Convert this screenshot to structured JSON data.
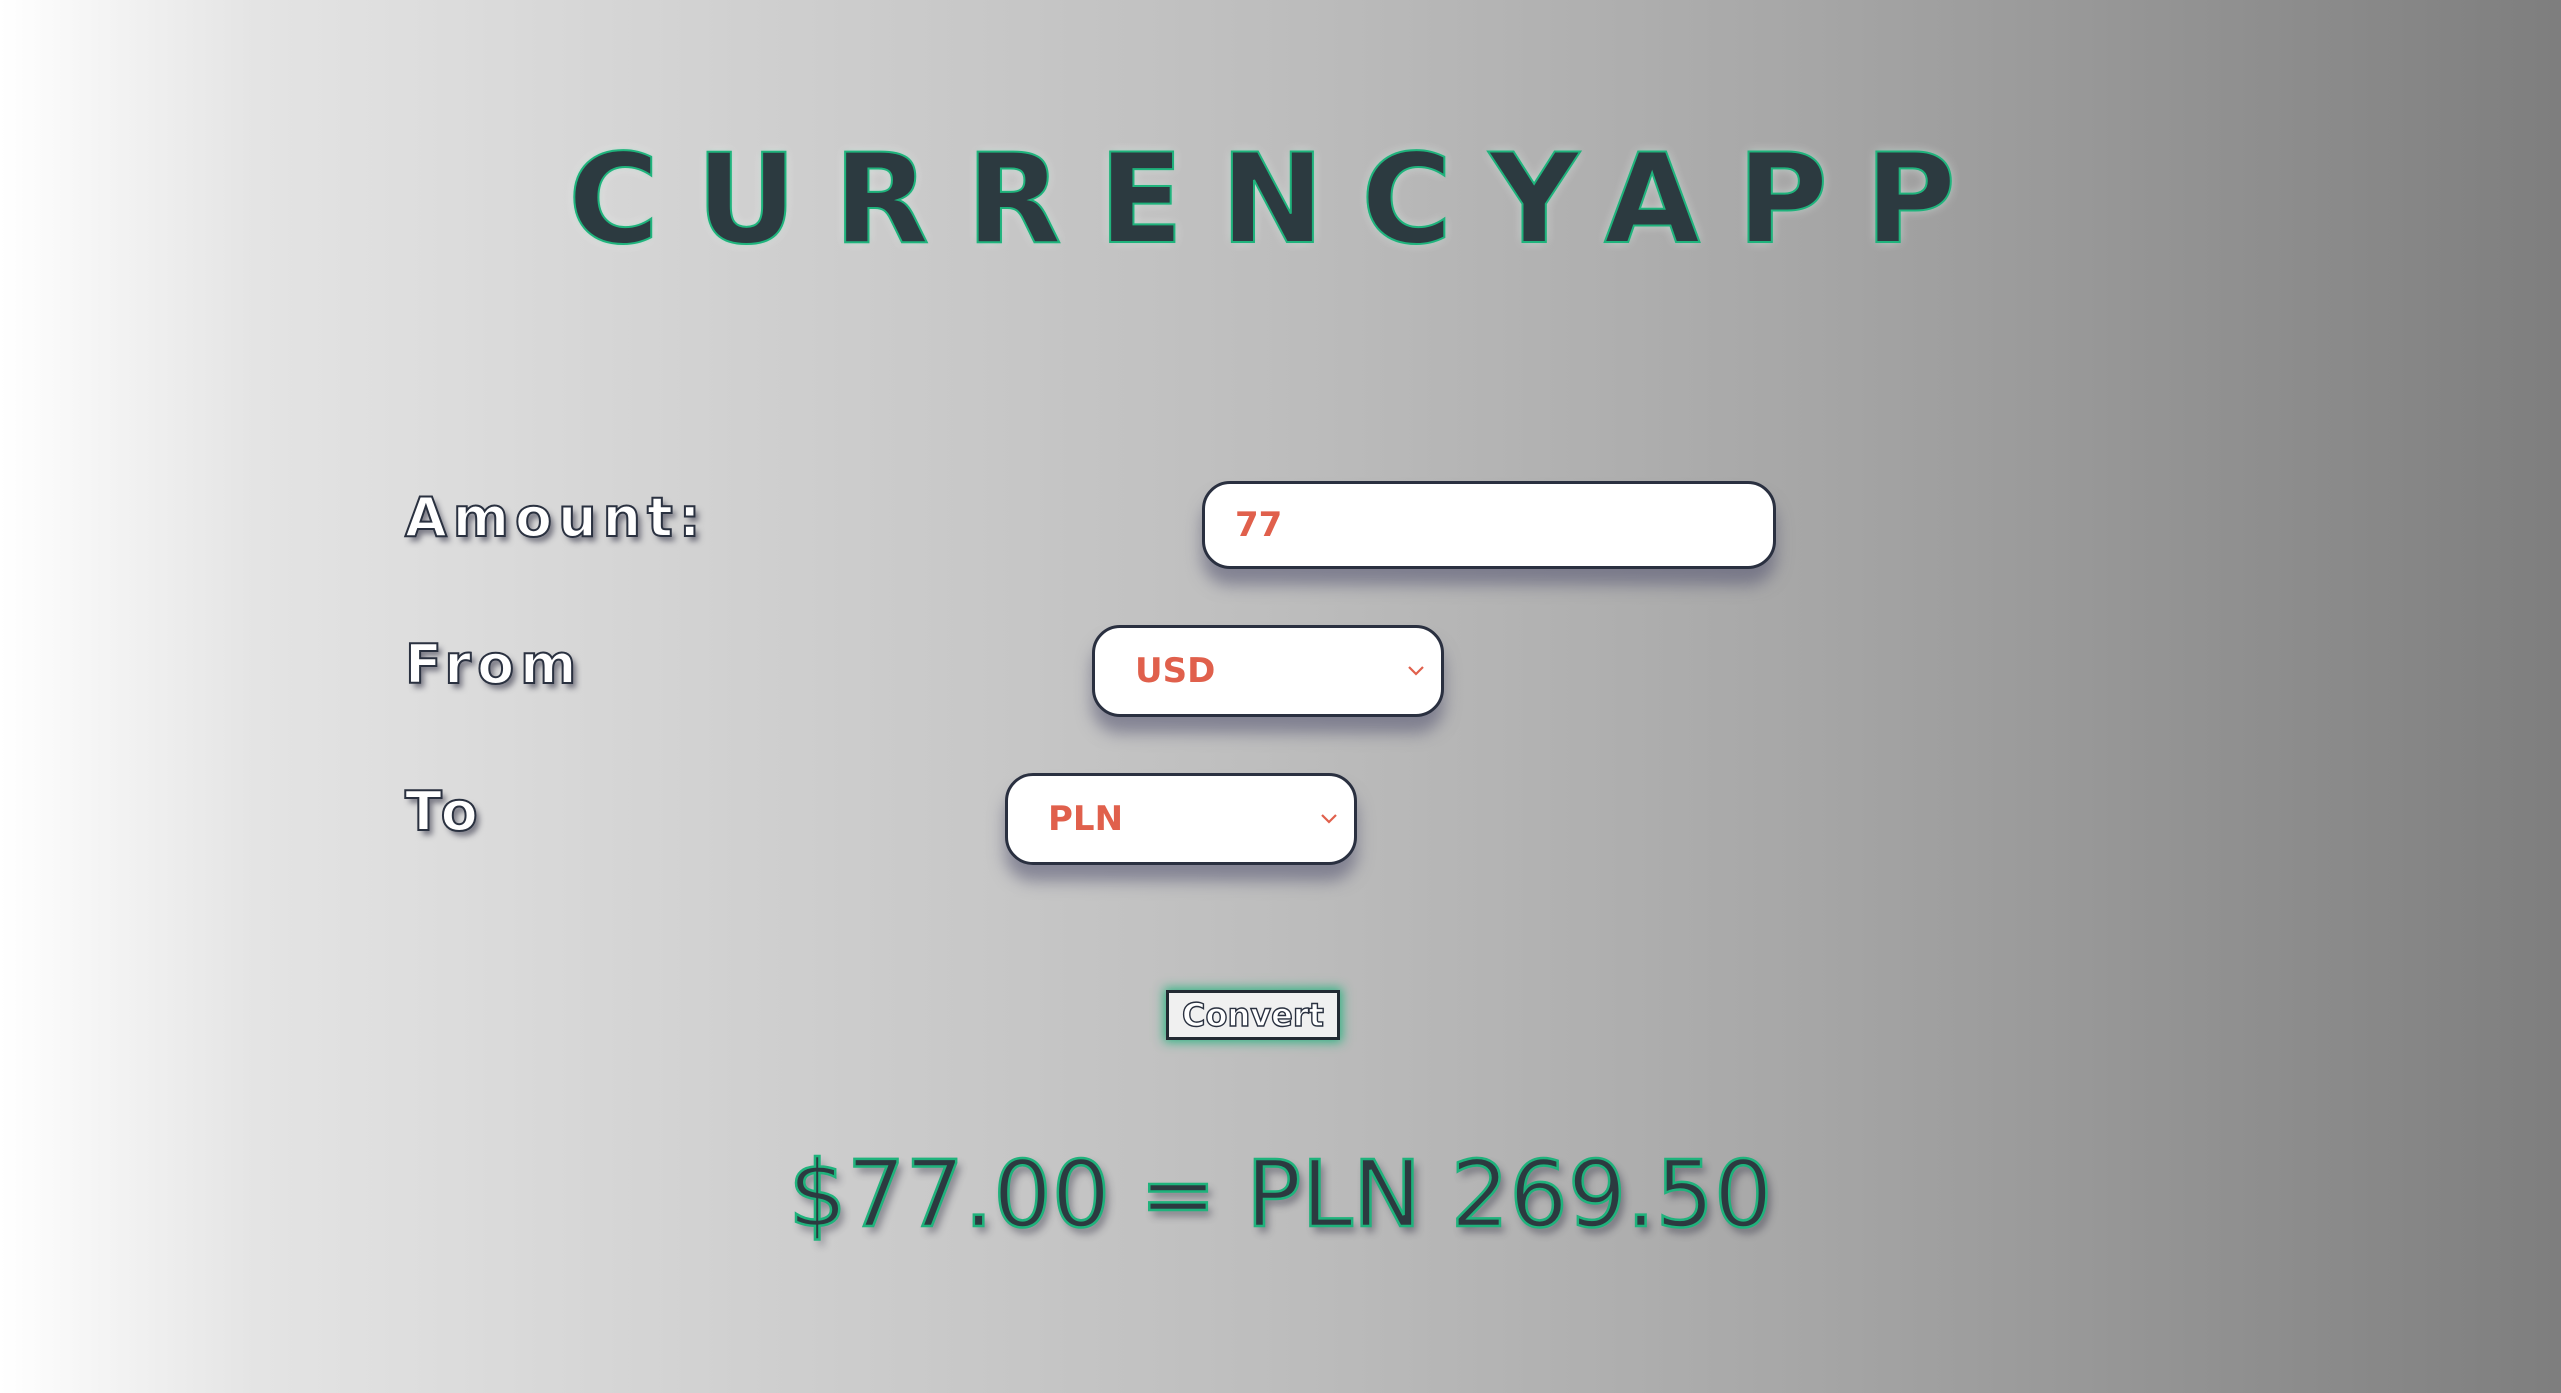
{
  "app": {
    "title": "CURRENCYAPP"
  },
  "form": {
    "amount_label": "Amount:",
    "amount_value": "77",
    "from_label": "From",
    "from_value": "USD",
    "to_label": "To",
    "to_value": "PLN",
    "convert_label": "Convert"
  },
  "result": {
    "text": "$77.00 = PLN 269.50"
  },
  "icons": {
    "dropdown": "chevron-down-icon"
  },
  "colors": {
    "title_fill": "#2c3a40",
    "accent_green": "#1fb37c",
    "field_text": "#e0604c",
    "field_border": "#2a3040"
  }
}
